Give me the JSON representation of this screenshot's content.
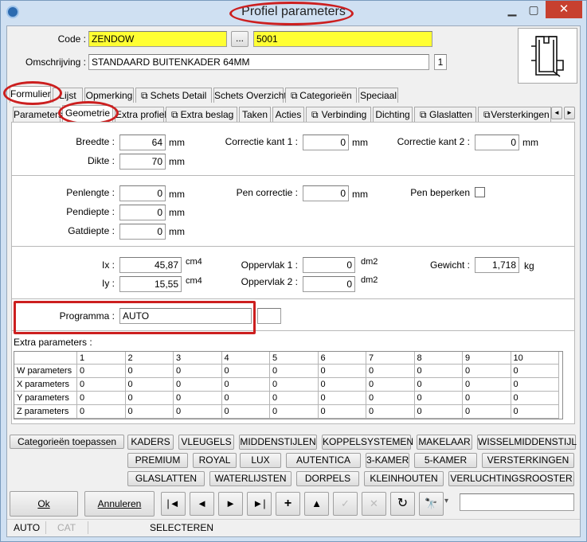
{
  "window": {
    "title": "Profiel parameters"
  },
  "header": {
    "code_label": "Code :",
    "code_value": "ZENDOW",
    "browse_label": "...",
    "number_value": "5001",
    "description_label": "Omschrijving :",
    "description_value": "STANDAARD BUITENKADER 64MM",
    "count_value": "1"
  },
  "main_tabs": [
    {
      "label": "Formulier"
    },
    {
      "label": "Lijst"
    },
    {
      "label": "Opmerking"
    },
    {
      "label": "Schets Detail"
    },
    {
      "label": "Schets Overzicht"
    },
    {
      "label": "Categorieën"
    },
    {
      "label": "Speciaal"
    }
  ],
  "sub_tabs": [
    {
      "label": "Parameters"
    },
    {
      "label": "Geometrie"
    },
    {
      "label": "Extra profiel"
    },
    {
      "label": "Extra beslag"
    },
    {
      "label": "Taken"
    },
    {
      "label": "Acties"
    },
    {
      "label": "Verbinding"
    },
    {
      "label": "Dichting"
    },
    {
      "label": "Glaslatten"
    },
    {
      "label": "Versterkingen"
    }
  ],
  "geometry": {
    "breedte_label": "Breedte :",
    "breedte_value": "64",
    "breedte_unit": "mm",
    "dikte_label": "Dikte :",
    "dikte_value": "70",
    "dikte_unit": "mm",
    "correctie1_label": "Correctie kant 1 :",
    "correctie1_value": "0",
    "correctie1_unit": "mm",
    "correctie2_label": "Correctie kant 2 :",
    "correctie2_value": "0",
    "correctie2_unit": "mm",
    "penlengte_label": "Penlengte :",
    "penlengte_value": "0",
    "penlengte_unit": "mm",
    "pendiepte_label": "Pendiepte :",
    "pendiepte_value": "0",
    "pendiepte_unit": "mm",
    "gatdiepte_label": "Gatdiepte :",
    "gatdiepte_value": "0",
    "gatdiepte_unit": "mm",
    "pencorrectie_label": "Pen correctie :",
    "pencorrectie_value": "0",
    "pencorrectie_unit": "mm",
    "penbeperken_label": "Pen beperken",
    "ix_label": "Ix :",
    "ix_value": "45,87",
    "ix_unit": "cm4",
    "iy_label": "Iy :",
    "iy_value": "15,55",
    "iy_unit": "cm4",
    "oppervlak1_label": "Oppervlak 1 :",
    "oppervlak1_value": "0",
    "oppervlak1_unit": "dm2",
    "oppervlak2_label": "Oppervlak 2 :",
    "oppervlak2_value": "0",
    "oppervlak2_unit": "dm2",
    "gewicht_label": "Gewicht :",
    "gewicht_value": "1,718",
    "gewicht_unit": "kg",
    "programma_label": "Programma :",
    "programma_value": "AUTO"
  },
  "extra_parameters": {
    "label": "Extra parameters :",
    "columns": [
      "1",
      "2",
      "3",
      "4",
      "5",
      "6",
      "7",
      "8",
      "9",
      "10"
    ],
    "rows": [
      {
        "name": "W parameters",
        "values": [
          "0",
          "0",
          "0",
          "0",
          "0",
          "0",
          "0",
          "0",
          "0",
          "0"
        ]
      },
      {
        "name": "X parameters",
        "values": [
          "0",
          "0",
          "0",
          "0",
          "0",
          "0",
          "0",
          "0",
          "0",
          "0"
        ]
      },
      {
        "name": "Y parameters",
        "values": [
          "0",
          "0",
          "0",
          "0",
          "0",
          "0",
          "0",
          "0",
          "0",
          "0"
        ]
      },
      {
        "name": "Z parameters",
        "values": [
          "0",
          "0",
          "0",
          "0",
          "0",
          "0",
          "0",
          "0",
          "0",
          "0"
        ]
      }
    ]
  },
  "categories": {
    "apply_label": "Categorieën toepassen",
    "row1": [
      "KADERS",
      "VLEUGELS",
      "MIDDENSTIJLEN",
      "KOPPELSYSTEMEN",
      "MAKELAAR",
      "WISSELMIDDENSTIJL"
    ],
    "row2": [
      "PREMIUM",
      "ROYAL",
      "LUX",
      "AUTENTICA",
      "3-KAMER",
      "5-KAMER",
      "VERSTERKINGEN"
    ],
    "row3": [
      "GLASLATTEN",
      "WATERLIJSTEN",
      "DORPELS",
      "KLEINHOUTEN",
      "VERLUCHTINGSROOSTER"
    ]
  },
  "footer": {
    "ok_label": "Ok",
    "cancel_label": "Annuleren",
    "nav": {
      "first": "|◄",
      "prev": "◄",
      "next": "►",
      "last": "►|",
      "add": "+",
      "up": "▲",
      "check": "✓",
      "cancel_x": "✕",
      "refresh": "↻",
      "find": "🔭",
      "more": "▾"
    },
    "search_value": ""
  },
  "status": {
    "mode1": "AUTO",
    "mode2": "CAT",
    "mode3": "SELECTEREN"
  },
  "colors": {
    "highlight_red": "#cc1f1f",
    "yellow_field": "#ffff33"
  }
}
